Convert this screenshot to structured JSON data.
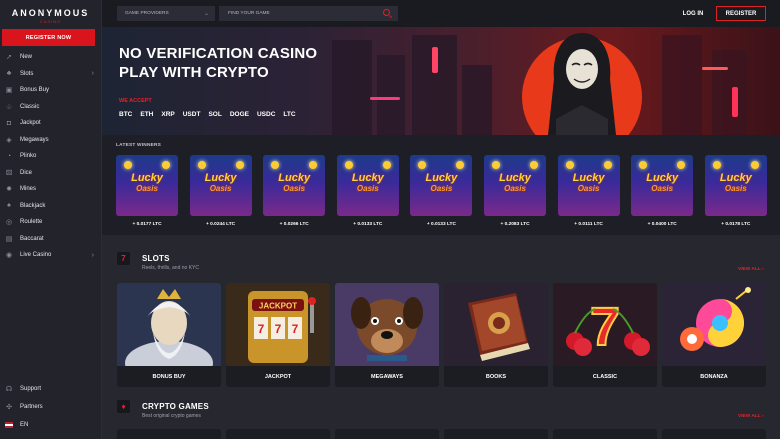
{
  "brand": {
    "name": "ANONYMOUS",
    "tag": "CASINO"
  },
  "sidebar": {
    "register_label": "REGISTER NOW",
    "items": [
      {
        "label": "New",
        "icon": "rocket-icon"
      },
      {
        "label": "Slots",
        "icon": "cherry-icon",
        "chevron": true
      },
      {
        "label": "Bonus Buy",
        "icon": "gift-icon"
      },
      {
        "label": "Classic",
        "icon": "cherries-icon"
      },
      {
        "label": "Jackpot",
        "icon": "lock-icon"
      },
      {
        "label": "Megaways",
        "icon": "megaways-icon"
      },
      {
        "label": "Plinko",
        "icon": "plinko-icon"
      },
      {
        "label": "Dice",
        "icon": "dice-icon"
      },
      {
        "label": "Mines",
        "icon": "mine-icon"
      },
      {
        "label": "Blackjack",
        "icon": "cards-icon"
      },
      {
        "label": "Roulette",
        "icon": "roulette-icon"
      },
      {
        "label": "Baccarat",
        "icon": "baccarat-icon"
      },
      {
        "label": "Live Casino",
        "icon": "live-icon",
        "chevron": true
      }
    ],
    "bottom": [
      {
        "label": "Support",
        "icon": "headset-icon"
      },
      {
        "label": "Partners",
        "icon": "partners-icon"
      },
      {
        "label": "EN",
        "icon": "flag-icon"
      }
    ]
  },
  "topbar": {
    "providers_label": "GAME PROVIDERS",
    "search_placeholder": "FIND YOUR GAME",
    "login_label": "LOG IN",
    "register_label": "REGISTER"
  },
  "hero": {
    "title_line1": "NO VERIFICATION CASINO",
    "title_line2": "PLAY WITH CRYPTO",
    "accept_label": "WE ACCEPT",
    "cryptos": [
      "BTC",
      "ETH",
      "XRP",
      "USDT",
      "SOL",
      "DOGE",
      "USDC",
      "LTC"
    ]
  },
  "winners": {
    "label": "LATEST WINNERS",
    "game_title": "Lucky",
    "game_subtitle": "Oasis",
    "items": [
      {
        "amount": "+ 0.0177 LTC"
      },
      {
        "amount": "+ 0.0244 LTC"
      },
      {
        "amount": "+ 0.0266 LTC"
      },
      {
        "amount": "+ 0.0133 LTC"
      },
      {
        "amount": "+ 0.0133 LTC"
      },
      {
        "amount": "+ 0.2083 LTC"
      },
      {
        "amount": "+ 0.0111 LTC"
      },
      {
        "amount": "+ 0.0400 LTC"
      },
      {
        "amount": "+ 0.0178 LTC"
      }
    ]
  },
  "slots": {
    "title": "SLOTS",
    "subtitle": "Reels, thrills, and no KYC",
    "view_all": "VIEW ALL",
    "cards": [
      {
        "label": "BONUS BUY"
      },
      {
        "label": "JACKPOT",
        "art_text": "JACKPOT"
      },
      {
        "label": "MEGAWAYS"
      },
      {
        "label": "BOOKS"
      },
      {
        "label": "CLASSIC"
      },
      {
        "label": "BONANZA"
      }
    ]
  },
  "crypto_games": {
    "title": "CRYPTO GAMES",
    "subtitle": "Best original crypto games",
    "view_all": "VIEW ALL"
  },
  "colors": {
    "accent": "#d9141d",
    "bg": "#1e1f26",
    "sidebar": "#22232b"
  }
}
